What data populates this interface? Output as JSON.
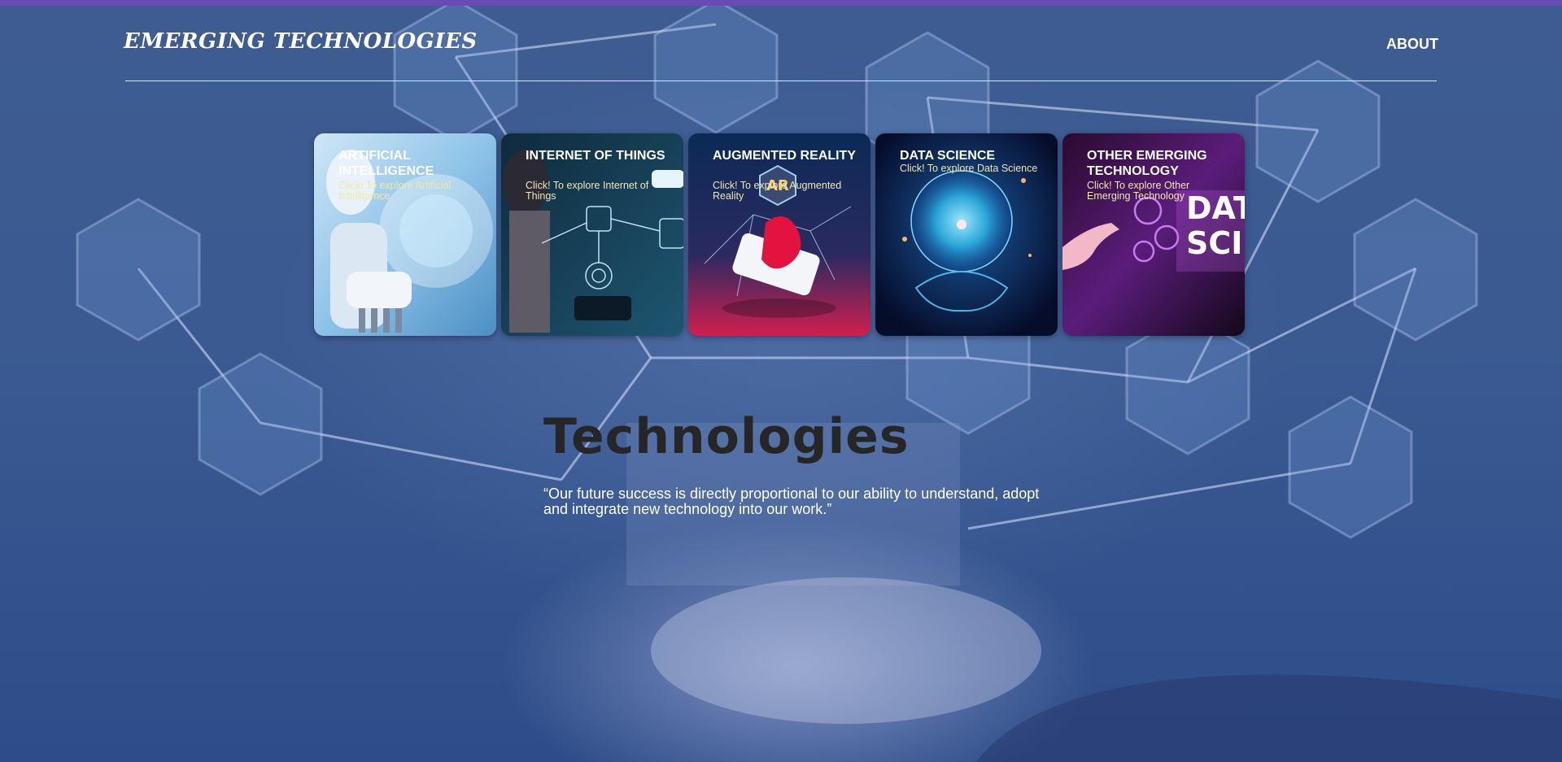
{
  "header": {
    "brand": "EMERGING TECHNOLOGIES",
    "nav": {
      "about": "ABOUT"
    }
  },
  "cards": [
    {
      "title": "ARTIFICIAL INTELLIGENCE",
      "subtitle": "Click! To explore Artificial Intelligence",
      "icon": "ai-robot-image"
    },
    {
      "title": "INTERNET OF THINGS",
      "subtitle": "Click! To explore Internet of Things",
      "icon": "iot-network-image"
    },
    {
      "title": "AUGMENTED REALITY",
      "subtitle": "Click! To explore Augmented Reality",
      "icon": "ar-phone-image"
    },
    {
      "title": "DATA SCIENCE",
      "subtitle": "Click! To explore Data Science",
      "icon": "data-globe-image"
    },
    {
      "title": "OTHER EMERGING TECHNOLOGY",
      "subtitle": "Click! To explore Other Emerging Technology",
      "icon": "data-science-gears-image"
    }
  ],
  "hero": {
    "title": "Technologies",
    "quote": "“Our future success is directly proportional to our ability to understand, adopt and integrate new technology into our work.”"
  },
  "card_art_text": {
    "ar_badge": "AR",
    "ds_banner_1": "DATA",
    "ds_banner_2": "SCIE"
  },
  "colors": {
    "accent_bar": "#6a4bb4",
    "background": "#2f4b83",
    "hero_title": "#262626",
    "card_subtitle": "#f0e9a6"
  }
}
